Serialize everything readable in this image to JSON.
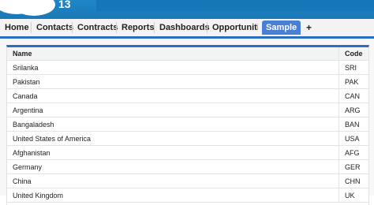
{
  "header": {
    "app_number": "13"
  },
  "tabs": [
    {
      "label": "Home"
    },
    {
      "label": "Contacts"
    },
    {
      "label": "Contracts"
    },
    {
      "label": "Reports"
    },
    {
      "label": "Dashboards"
    },
    {
      "label": "Opportunitie"
    },
    {
      "label": "Sample"
    },
    {
      "label": "+"
    }
  ],
  "table": {
    "columns": [
      "Name",
      "Code"
    ],
    "rows": [
      [
        "Srilanka",
        "SRI"
      ],
      [
        "Pakistan",
        "PAK"
      ],
      [
        "Canada",
        "CAN"
      ],
      [
        "Argentina",
        "ARG"
      ],
      [
        "Bangaladesh",
        "BAN"
      ],
      [
        "United States of America",
        "USA"
      ],
      [
        "Afghanistan",
        "AFG"
      ],
      [
        "Germany",
        "GER"
      ],
      [
        "China",
        "CHN"
      ],
      [
        "United Kingdom",
        "UK"
      ]
    ]
  },
  "colors": {
    "header": "#1a78b8",
    "accent": "#2a6ec2",
    "active_tab": "#4a7fd6"
  }
}
